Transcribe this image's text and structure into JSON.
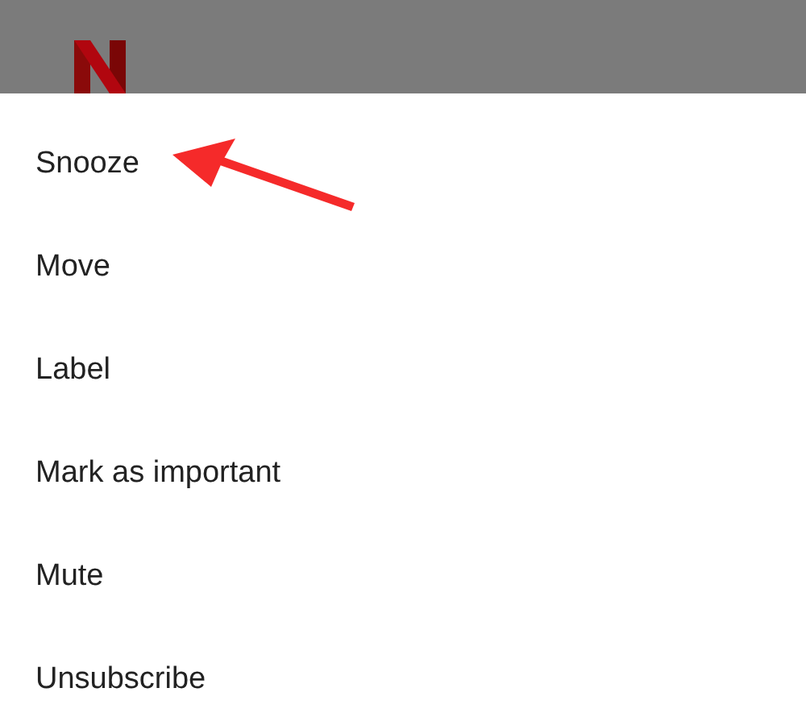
{
  "menu": {
    "items": [
      {
        "label": "Snooze"
      },
      {
        "label": "Move"
      },
      {
        "label": "Label"
      },
      {
        "label": "Mark as important"
      },
      {
        "label": "Mute"
      },
      {
        "label": "Unsubscribe"
      }
    ]
  }
}
